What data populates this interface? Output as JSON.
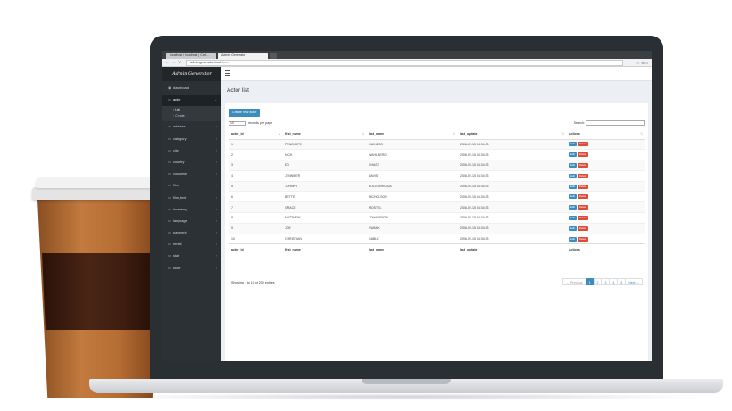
{
  "browser": {
    "tabs": [
      "localhost / localhost | Cart...",
      "Admin Generator"
    ],
    "url": "admingenerator.local",
    "url_path": "/actor"
  },
  "sidebar": {
    "brand": "Admin Generator",
    "items": [
      {
        "label": "dashboard",
        "icon": "dashboard-icon"
      },
      {
        "label": "actor",
        "icon": "folder-icon",
        "active": true,
        "sub": [
          "List",
          "Create"
        ]
      },
      {
        "label": "address",
        "icon": "folder-icon"
      },
      {
        "label": "category",
        "icon": "folder-icon"
      },
      {
        "label": "city",
        "icon": "folder-icon"
      },
      {
        "label": "country",
        "icon": "folder-icon"
      },
      {
        "label": "customer",
        "icon": "folder-icon"
      },
      {
        "label": "film",
        "icon": "folder-icon"
      },
      {
        "label": "film_text",
        "icon": "folder-icon"
      },
      {
        "label": "inventory",
        "icon": "folder-icon"
      },
      {
        "label": "language",
        "icon": "folder-icon"
      },
      {
        "label": "payment",
        "icon": "folder-icon"
      },
      {
        "label": "rental",
        "icon": "folder-icon"
      },
      {
        "label": "staff",
        "icon": "folder-icon"
      },
      {
        "label": "store",
        "icon": "folder-icon"
      }
    ]
  },
  "page": {
    "title": "Actor list",
    "create_label": "Create new actor",
    "page_length": "10",
    "records_label": "records per page",
    "search_label": "Search:",
    "columns": [
      "actor_id",
      "first_name",
      "last_name",
      "last_update",
      "Actions"
    ],
    "rows": [
      [
        "1",
        "PENELOPE",
        "GUINESS",
        "2006-02-15 04:34:33"
      ],
      [
        "2",
        "NICK",
        "WAHLBERG",
        "2006-02-15 04:34:33"
      ],
      [
        "3",
        "ED",
        "CHASE",
        "2006-02-15 04:34:33"
      ],
      [
        "4",
        "JENNIFER",
        "DAVIS",
        "2006-02-15 04:34:33"
      ],
      [
        "5",
        "JOHNNY",
        "LOLLOBRIGIDA",
        "2006-02-15 04:34:33"
      ],
      [
        "6",
        "BETTE",
        "NICHOLSON",
        "2006-02-15 04:34:33"
      ],
      [
        "7",
        "GRACE",
        "MOSTEL",
        "2006-02-15 04:34:33"
      ],
      [
        "8",
        "MATTHEW",
        "JOHANSSON",
        "2006-02-15 04:34:33"
      ],
      [
        "9",
        "JOE",
        "SWANK",
        "2006-02-15 04:34:33"
      ],
      [
        "10",
        "CHRISTIAN",
        "GABLE",
        "2006-02-15 04:34:33"
      ]
    ],
    "edit_label": "Edit",
    "delete_label": "Delete",
    "info": "Showing 1 to 10 of 200 entries",
    "pager": {
      "previous": "← Previous",
      "pages": [
        "1",
        "2",
        "3",
        "4",
        "5"
      ],
      "next": "Next →",
      "current": "1"
    }
  },
  "colors": {
    "accent": "#3c8dbc",
    "danger": "#dd4b39",
    "sidebar": "#2c3135"
  }
}
